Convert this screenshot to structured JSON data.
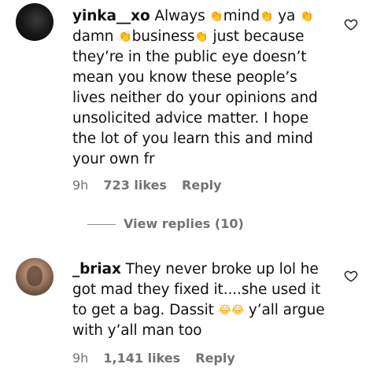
{
  "comments": [
    {
      "username": "yinka__xo",
      "segments": [
        "Always ",
        "mind",
        " ya ",
        "damn ",
        "business",
        " just because they’re in the public eye doesn’t mean you know these people’s lives neither do your opinions and unsolicited advice matter. I hope the lot of you learn this and mind your own fr"
      ],
      "time": "9h",
      "likes": "723 likes",
      "reply_label": "Reply",
      "icons": {
        "heart": "heart-outline-icon",
        "clap": "clapping-hands-emoji"
      }
    },
    {
      "username": "_briax",
      "segments": [
        "They never broke up lol he got mad they fixed it....she used it to get a bag. Dassit ",
        " y’all argue with y’all man too"
      ],
      "time": "9h",
      "likes": "1,141 likes",
      "reply_label": "Reply",
      "icons": {
        "heart": "heart-outline-icon",
        "joy": "tears-of-joy-emoji"
      }
    }
  ],
  "view_replies": {
    "label": "View replies (10)"
  },
  "colors": {
    "text": "#111111",
    "meta": "#737373",
    "background": "#ffffff"
  }
}
